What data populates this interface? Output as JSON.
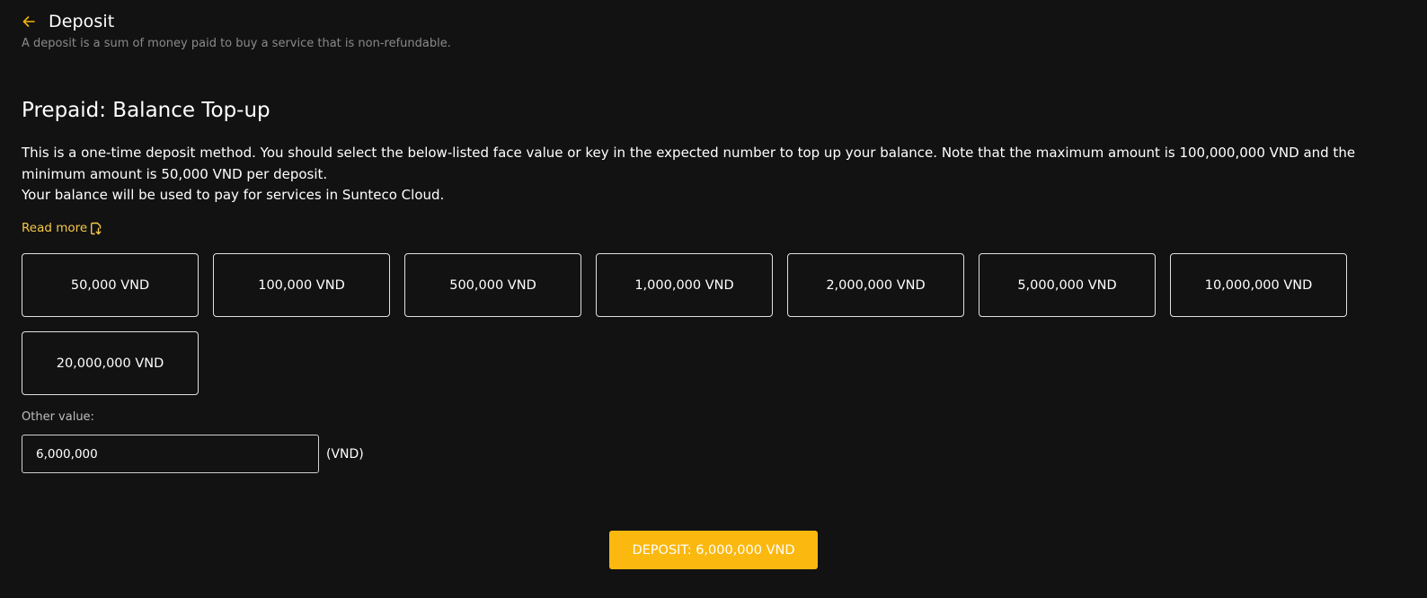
{
  "header": {
    "title": "Deposit",
    "subtitle": "A deposit is a sum of money paid to buy a service that is non-refundable."
  },
  "section": {
    "title": "Prepaid: Balance Top-up",
    "description_line1": "This is a one-time deposit method. You should select the below-listed face value or key in the expected number to top up your balance. Note that the maximum amount is 100,000,000 VND and the minimum amount is 50,000 VND per deposit.",
    "description_line2": "Your balance will be used to pay for services in Sunteco Cloud.",
    "read_more": "Read more"
  },
  "options": [
    {
      "label": "50,000 VND"
    },
    {
      "label": "100,000 VND"
    },
    {
      "label": "500,000 VND"
    },
    {
      "label": "1,000,000 VND"
    },
    {
      "label": "2,000,000 VND"
    },
    {
      "label": "5,000,000 VND"
    },
    {
      "label": "10,000,000 VND"
    },
    {
      "label": "20,000,000 VND"
    }
  ],
  "other": {
    "label": "Other value:",
    "value": "6,000,000",
    "unit": "(VND)"
  },
  "deposit_button": {
    "label": "DEPOSIT: 6,000,000 VND"
  },
  "colors": {
    "accent": "#fbb80f",
    "link": "#f7c948",
    "background": "#121212"
  },
  "icons": {
    "back": "arrow-left-icon",
    "read_more": "external-doc-icon"
  }
}
